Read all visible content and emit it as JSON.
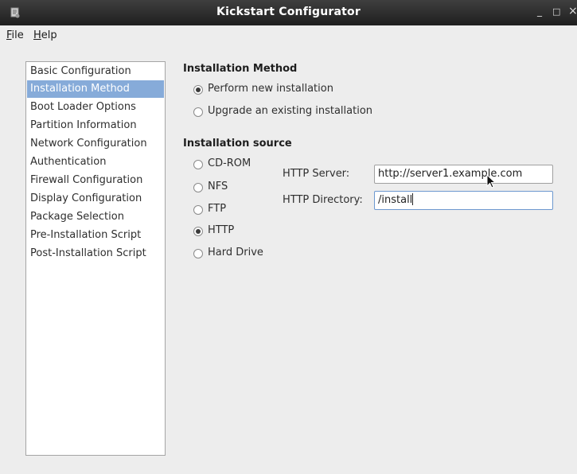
{
  "window": {
    "title": "Kickstart Configurator",
    "minimize_glyph": "_",
    "maximize_glyph": "□",
    "close_glyph": "×"
  },
  "menu": {
    "file": {
      "accel": "F",
      "rest": "ile"
    },
    "help": {
      "accel": "H",
      "rest": "elp"
    }
  },
  "sidebar": {
    "selected_index": 1,
    "items": [
      {
        "label": "Basic Configuration"
      },
      {
        "label": "Installation Method"
      },
      {
        "label": "Boot Loader Options"
      },
      {
        "label": "Partition Information"
      },
      {
        "label": "Network Configuration"
      },
      {
        "label": "Authentication"
      },
      {
        "label": "Firewall Configuration"
      },
      {
        "label": "Display Configuration"
      },
      {
        "label": "Package Selection"
      },
      {
        "label": "Pre-Installation Script"
      },
      {
        "label": "Post-Installation Script"
      }
    ]
  },
  "installation_method": {
    "heading": "Installation Method",
    "options": [
      {
        "label": "Perform new installation",
        "checked": true
      },
      {
        "label": "Upgrade an existing installation",
        "checked": false
      }
    ]
  },
  "installation_source": {
    "heading": "Installation source",
    "options": [
      {
        "label": "CD-ROM",
        "checked": false
      },
      {
        "label": "NFS",
        "checked": false
      },
      {
        "label": "FTP",
        "checked": false
      },
      {
        "label": "HTTP",
        "checked": true
      },
      {
        "label": "Hard Drive",
        "checked": false
      }
    ]
  },
  "http": {
    "server_label": "HTTP Server:",
    "server_value": "http://server1.example.com",
    "directory_label": "HTTP Directory:",
    "directory_value": "/install"
  },
  "colors": {
    "titlebar": "#2b2b2b",
    "selection": "#86abd9",
    "window_bg": "#ededed"
  }
}
